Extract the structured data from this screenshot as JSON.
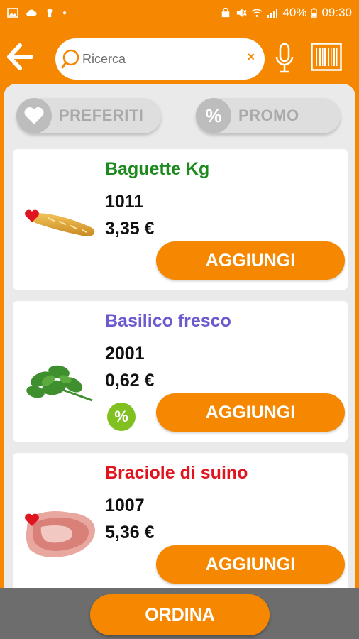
{
  "status": {
    "battery": "40%",
    "time": "09:30"
  },
  "search": {
    "placeholder": "Ricerca",
    "clear": "×"
  },
  "filters": {
    "favorites": "PREFERITI",
    "promo": "PROMO",
    "promo_symbol": "%"
  },
  "products": [
    {
      "name": "Baguette Kg",
      "code": "1011",
      "price": "3,35 €",
      "name_color": "#1e8a1e",
      "favorite": true,
      "promo": false,
      "button": "AGGIUNGI"
    },
    {
      "name": "Basilico fresco",
      "code": "2001",
      "price": "0,62 €",
      "name_color": "#6a5acd",
      "favorite": false,
      "promo": true,
      "button": "AGGIUNGI"
    },
    {
      "name": "Braciole di suino",
      "code": "1007",
      "price": "5,36 €",
      "name_color": "#e0141e",
      "favorite": true,
      "promo": false,
      "button": "AGGIUNGI"
    }
  ],
  "promo_badge": "%",
  "order_button": "ORDINA",
  "colors": {
    "accent": "#f58800",
    "promo_green": "#80c021"
  }
}
